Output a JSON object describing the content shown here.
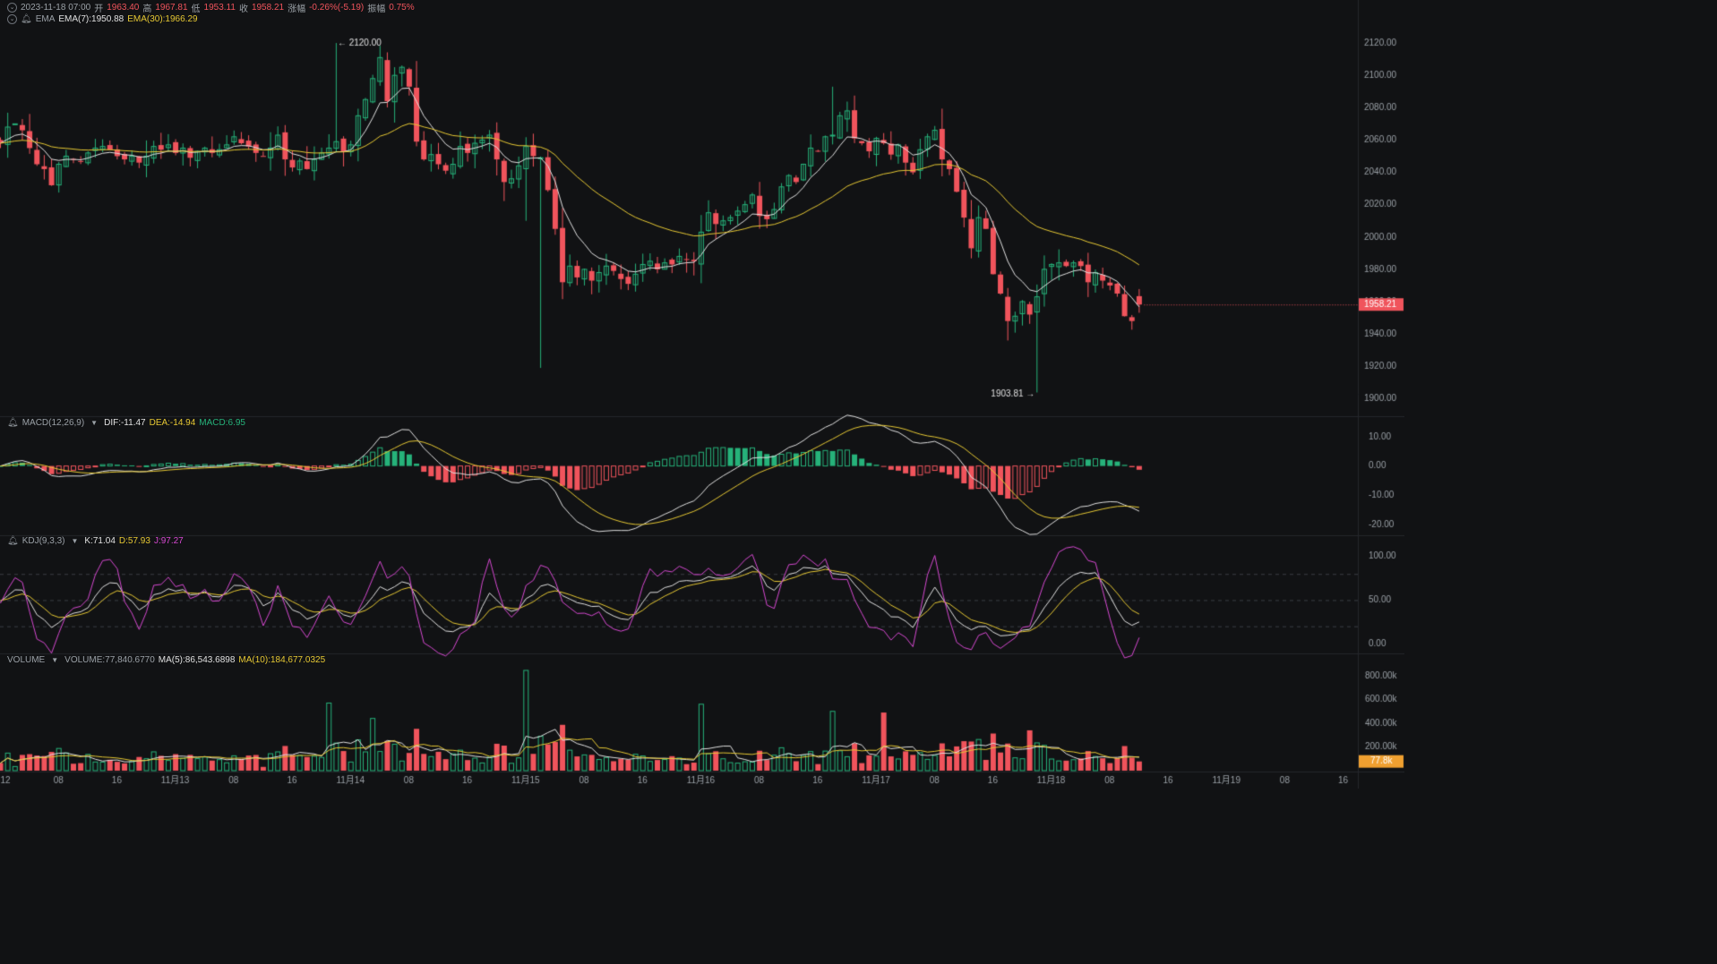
{
  "header": {
    "date": "2023-11-18 07:00",
    "open_label": "开",
    "open": "1963.40",
    "high_label": "高",
    "high": "1967.81",
    "low_label": "低",
    "low": "1953.11",
    "close_label": "收",
    "close": "1958.21",
    "change_label": "涨幅",
    "change": "-0.26%(-5.19)",
    "amp_label": "振幅",
    "amp": "0.75%"
  },
  "ema_legend": {
    "name": "EMA",
    "ema7": "EMA(7):1950.88",
    "ema30": "EMA(30):1966.29"
  },
  "macd_legend": {
    "name": "MACD(12,26,9)",
    "dif": "DIF:-11.47",
    "dea": "DEA:-14.94",
    "macd": "MACD:6.95"
  },
  "kdj_legend": {
    "name": "KDJ(9,3,3)",
    "k": "K:71.04",
    "d": "D:57.93",
    "j": "J:97.27"
  },
  "vol_legend": {
    "name": "VOLUME",
    "vol": "VOLUME:77,840.6770",
    "ma5": "MA(5):86,543.6898",
    "ma10": "MA(10):184,677.0325"
  },
  "colors": {
    "up": "#26b27a",
    "down": "#f0545c",
    "ema7": "#e0e0e0",
    "ema30": "#e6c833",
    "kdj_j": "#d548d0",
    "badge_vol": "#f0a030"
  },
  "chart_data": {
    "type": "candlestick",
    "price_axis": {
      "ticks": [
        "2120.00",
        "2100.00",
        "2080.00",
        "2060.00",
        "2040.00",
        "2020.00",
        "2000.00",
        "1980.00",
        "1960.00",
        "1940.00",
        "1920.00",
        "1900.00"
      ],
      "range": [
        1893,
        2130
      ]
    },
    "current_price": "1958.21",
    "max_annotation": "2120.00",
    "min_annotation": "1903.81",
    "macd_axis": {
      "ticks": [
        "10.00",
        "0.00",
        "-10.00",
        "-20.00"
      ],
      "range": [
        -23,
        13
      ]
    },
    "kdj_axis": {
      "ticks": [
        "100.00",
        "50.00",
        "0.00"
      ],
      "range": [
        -5,
        110
      ],
      "dashed_levels": [
        80,
        50,
        20
      ]
    },
    "volume_axis": {
      "ticks": [
        "800.00k",
        "600.00k",
        "400.00k",
        "200.00k"
      ],
      "range": [
        0,
        860
      ],
      "current_badge": "77.8k"
    },
    "x_labels": [
      {
        "text": "12",
        "idx": 0
      },
      {
        "text": "08",
        "idx": 8
      },
      {
        "text": "16",
        "idx": 16
      },
      {
        "text": "11月13",
        "idx": 24
      },
      {
        "text": "08",
        "idx": 32
      },
      {
        "text": "16",
        "idx": 40
      },
      {
        "text": "11月14",
        "idx": 48
      },
      {
        "text": "08",
        "idx": 56
      },
      {
        "text": "16",
        "idx": 64
      },
      {
        "text": "11月15",
        "idx": 72
      },
      {
        "text": "08",
        "idx": 80
      },
      {
        "text": "16",
        "idx": 88
      },
      {
        "text": "11月16",
        "idx": 96
      },
      {
        "text": "08",
        "idx": 104
      },
      {
        "text": "16",
        "idx": 112
      },
      {
        "text": "11月17",
        "idx": 120
      },
      {
        "text": "08",
        "idx": 128
      },
      {
        "text": "16",
        "idx": 136
      },
      {
        "text": "11月18",
        "idx": 144
      },
      {
        "text": "08",
        "idx": 152
      },
      {
        "text": "16",
        "idx": 160
      },
      {
        "text": "11月19",
        "idx": 168
      },
      {
        "text": "08",
        "idx": 176
      },
      {
        "text": "16",
        "idx": 184
      }
    ],
    "close_prices": [
      2058,
      2068,
      2070,
      2066,
      2055,
      2045,
      2042,
      2032,
      2045,
      2050,
      2048,
      2047,
      2052,
      2055,
      2056,
      2054,
      2050,
      2048,
      2050,
      2046,
      2050,
      2056,
      2054,
      2057,
      2052,
      2055,
      2049,
      2053,
      2055,
      2052,
      2054,
      2057,
      2062,
      2058,
      2056,
      2052,
      2050,
      2055,
      2063,
      2048,
      2043,
      2047,
      2042,
      2048,
      2052,
      2055,
      2059,
      2053,
      2057,
      2075,
      2085,
      2098,
      2111,
      2084,
      2100,
      2105,
      2093,
      2059,
      2048,
      2051,
      2045,
      2041,
      2045,
      2056,
      2052,
      2058,
      2060,
      2063,
      2048,
      2034,
      2036,
      2044,
      2056,
      2050,
      2049,
      2029,
      2005,
      1972,
      1982,
      1975,
      1980,
      1973,
      1978,
      1982,
      1979,
      1974,
      1971,
      1977,
      1983,
      1985,
      1980,
      1984,
      1983,
      1988,
      1986,
      1985,
      2003,
      2015,
      2008,
      2010,
      2012,
      2016,
      2020,
      2026,
      2013,
      2011,
      2017,
      2031,
      2038,
      2034,
      2045,
      2055,
      2053,
      2062,
      2063,
      2075,
      2078,
      2061,
      2058,
      2053,
      2061,
      2058,
      2051,
      2057,
      2046,
      2040,
      2054,
      2062,
      2066,
      2048,
      2042,
      2028,
      2012,
      1993,
      2012,
      2005,
      1977,
      1965,
      1948,
      1951,
      1960,
      1952,
      1963,
      1980,
      1983,
      1984,
      1982,
      1984,
      1982,
      1972,
      1978,
      1973,
      1970,
      1965,
      1951,
      1948,
      1940
    ]
  }
}
